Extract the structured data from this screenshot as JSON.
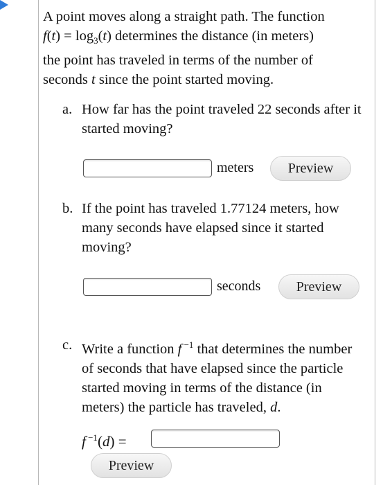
{
  "intro": {
    "text_1": "A point moves along a straight path. The function",
    "func": "f(t) = log",
    "base": "3",
    "text_2": "(t) determines the distance (in meters)",
    "text_3": "the point has traveled in terms of the number of",
    "text_4_a": "seconds ",
    "text_4_var": "t",
    "text_4_b": " since the point started moving."
  },
  "part_a": {
    "letter": "a.",
    "question": "How far has the point traveled 22 seconds after it started moving?",
    "input_value": "",
    "unit": "meters",
    "preview_label": "Preview"
  },
  "part_b": {
    "letter": "b.",
    "question": "If the point has traveled 1.77124 meters, how many seconds have elapsed since it started moving?",
    "input_value": "",
    "unit": "seconds",
    "preview_label": "Preview"
  },
  "part_c": {
    "letter": "c.",
    "q_1": "Write a function ",
    "f": "f",
    "inv": " −1",
    "q_2": " that determines the number of seconds that have elapsed since the particle started moving in terms of the distance (in meters) the particle has traveled, ",
    "d": "d",
    "q_3": ".",
    "func_label_f": "f",
    "func_label_rest": "(d)",
    "func_label_eq": " =",
    "input_value": "",
    "preview_label": "Preview"
  },
  "colors": {
    "accent": "#2f7bd8",
    "border": "#b8b8b8"
  }
}
